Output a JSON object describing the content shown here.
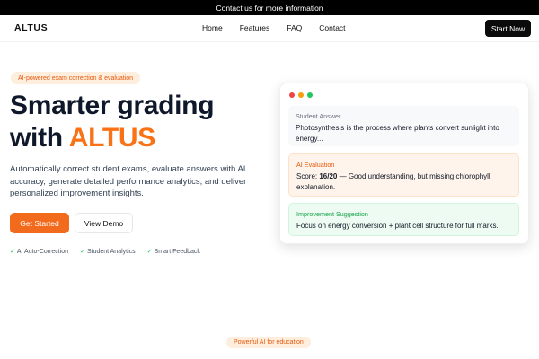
{
  "topbar": {
    "text": "Contact us for more information"
  },
  "nav": {
    "logo": "ALTUS",
    "links": [
      "Home",
      "Features",
      "FAQ",
      "Contact"
    ],
    "cta": "Start Now"
  },
  "hero": {
    "badge": "AI-powered exam correction & evaluation",
    "headline_line1": "Smarter grading",
    "headline_with": "with ",
    "headline_accent": "ALTUS",
    "description": "Automatically correct student exams, evaluate answers with AI accuracy, generate detailed performance analytics, and deliver personalized improvement insights.",
    "primary_button": "Get Started",
    "secondary_button": "View Demo",
    "features": [
      "AI Auto-Correction",
      "Student Analytics",
      "Smart Feedback"
    ]
  },
  "demo_card": {
    "window_dots": [
      "#ef4444",
      "#f59e0b",
      "#22c55e"
    ],
    "student_answer": {
      "title": "Student Answer",
      "body": "Photosynthesis is the process where plants convert sunlight into energy..."
    },
    "ai_evaluation": {
      "title": "AI Evaluation",
      "score_label": "Score: ",
      "score_value": "16/20",
      "comment": " — Good understanding, but missing chlorophyll explanation."
    },
    "improvement": {
      "title": "Improvement Suggestion",
      "body": "Focus on energy conversion + plant cell structure for full marks."
    }
  },
  "section_badge": "Powerful AI for education",
  "colors": {
    "accent": "#f97316",
    "primary_button": "#f26a1b",
    "dark": "#0b0b0b",
    "success": "#16a34a"
  }
}
